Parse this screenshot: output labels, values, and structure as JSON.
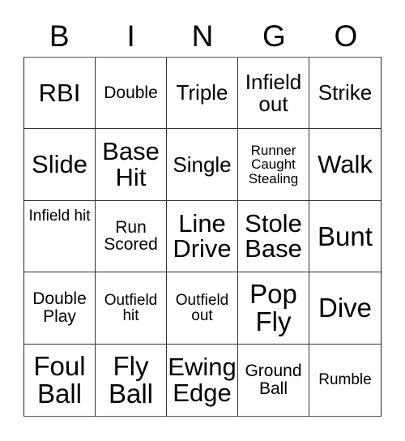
{
  "card": {
    "type": "bingo-card",
    "header_letters": [
      "B",
      "I",
      "N",
      "G",
      "O"
    ],
    "columns": 5,
    "rows": 5,
    "free_space": false,
    "theme": "baseball",
    "colors": {
      "background": "#ffffff",
      "text": "#000000",
      "grid_line": "#333333"
    },
    "cells": [
      {
        "text": "RBI",
        "size": "fs-lg",
        "lines": 1,
        "align": "center"
      },
      {
        "text": "Double",
        "size": "fs-sm",
        "lines": 1,
        "align": "center"
      },
      {
        "text": "Triple",
        "size": "fs-md",
        "lines": 1,
        "align": "center"
      },
      {
        "text": "Infield out",
        "size": "fs-md",
        "lines": 2,
        "align": "center"
      },
      {
        "text": "Strike",
        "size": "fs-md",
        "lines": 1,
        "align": "center"
      },
      {
        "text": "Slide",
        "size": "fs-lg",
        "lines": 1,
        "align": "center"
      },
      {
        "text": "Base Hit",
        "size": "fs-lg",
        "lines": 2,
        "align": "center"
      },
      {
        "text": "Single",
        "size": "fs-md",
        "lines": 1,
        "align": "center"
      },
      {
        "text": "Runner Caught Stealing",
        "size": "fs-xxs",
        "lines": 3,
        "align": "center"
      },
      {
        "text": "Walk",
        "size": "fs-lg",
        "lines": 1,
        "align": "center"
      },
      {
        "text": "Infield hit",
        "size": "fs-xs",
        "lines": 2,
        "align": "top"
      },
      {
        "text": "Run Scored",
        "size": "fs-sm",
        "lines": 2,
        "align": "center"
      },
      {
        "text": "Line Drive",
        "size": "fs-lg",
        "lines": 2,
        "align": "center"
      },
      {
        "text": "Stole Base",
        "size": "fs-lg",
        "lines": 2,
        "align": "center"
      },
      {
        "text": "Bunt",
        "size": "fs-xl",
        "lines": 1,
        "align": "center"
      },
      {
        "text": "Double Play",
        "size": "fs-sm",
        "lines": 2,
        "align": "center"
      },
      {
        "text": "Outfield hit",
        "size": "fs-xs",
        "lines": 2,
        "align": "center"
      },
      {
        "text": "Outfield out",
        "size": "fs-xs",
        "lines": 2,
        "align": "center"
      },
      {
        "text": "Pop Fly",
        "size": "fs-xl",
        "lines": 2,
        "align": "center"
      },
      {
        "text": "Dive",
        "size": "fs-xl",
        "lines": 1,
        "align": "center"
      },
      {
        "text": "Foul Ball",
        "size": "fs-xl",
        "lines": 2,
        "align": "center"
      },
      {
        "text": "Fly Ball",
        "size": "fs-xl",
        "lines": 2,
        "align": "center"
      },
      {
        "text": "Ewing Edge",
        "size": "fs-lg",
        "lines": 2,
        "align": "center"
      },
      {
        "text": "Ground Ball",
        "size": "fs-sm",
        "lines": 2,
        "align": "center"
      },
      {
        "text": "Rumble",
        "size": "fs-xs",
        "lines": 1,
        "align": "center"
      }
    ]
  }
}
